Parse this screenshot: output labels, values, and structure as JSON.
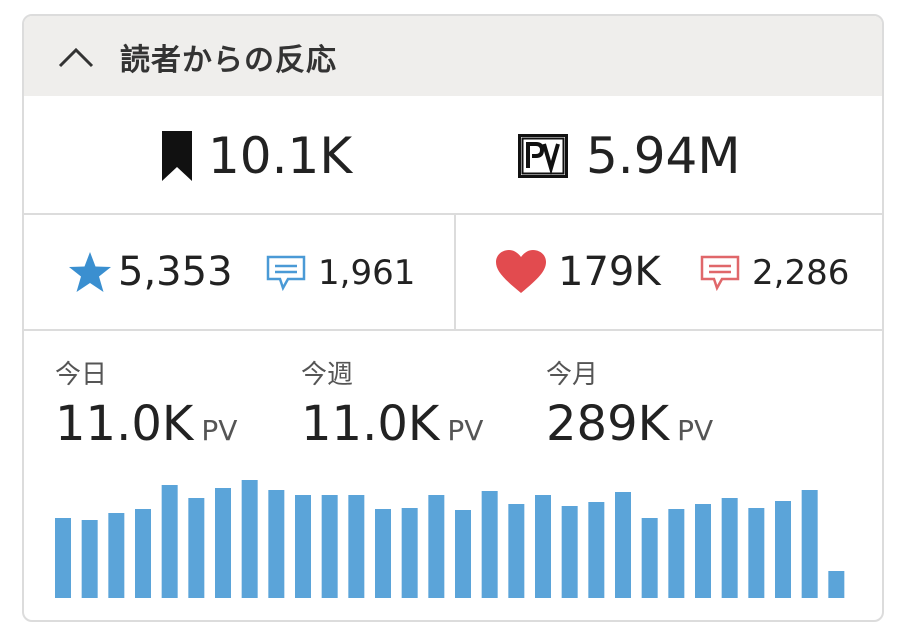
{
  "header": {
    "title": "読者からの反応",
    "expand_icon": "chevron-up-icon"
  },
  "stats": {
    "bookmarks": {
      "icon": "bookmark-icon",
      "value": "10.1K"
    },
    "pageviews": {
      "icon": "pv-icon",
      "value": "5.94M"
    }
  },
  "reactions": {
    "stars": {
      "icon": "star-icon",
      "value": "5,353",
      "color": "#3a8fd0"
    },
    "star_comments": {
      "icon": "comment-icon",
      "value": "1,961",
      "color": "#4a9ad6"
    },
    "hearts": {
      "icon": "heart-icon",
      "value": "179K",
      "color": "#e24b4f"
    },
    "heart_comments": {
      "icon": "comment-icon",
      "value": "2,286",
      "color": "#e0676a"
    }
  },
  "periods": [
    {
      "label": "今日",
      "value": "11.0K",
      "unit": "PV"
    },
    {
      "label": "今週",
      "value": "11.0K",
      "unit": "PV"
    },
    {
      "label": "今月",
      "value": "289K",
      "unit": "PV"
    }
  ],
  "chart_data": {
    "type": "bar",
    "color": "#5ba4d9",
    "values": [
      80,
      78,
      85,
      89,
      113,
      100,
      110,
      118,
      108,
      103,
      103,
      103,
      89,
      90,
      103,
      88,
      107,
      94,
      103,
      92,
      96,
      106,
      80,
      89,
      94,
      100,
      90,
      97,
      108,
      27
    ],
    "ylim": [
      0,
      122
    ]
  }
}
